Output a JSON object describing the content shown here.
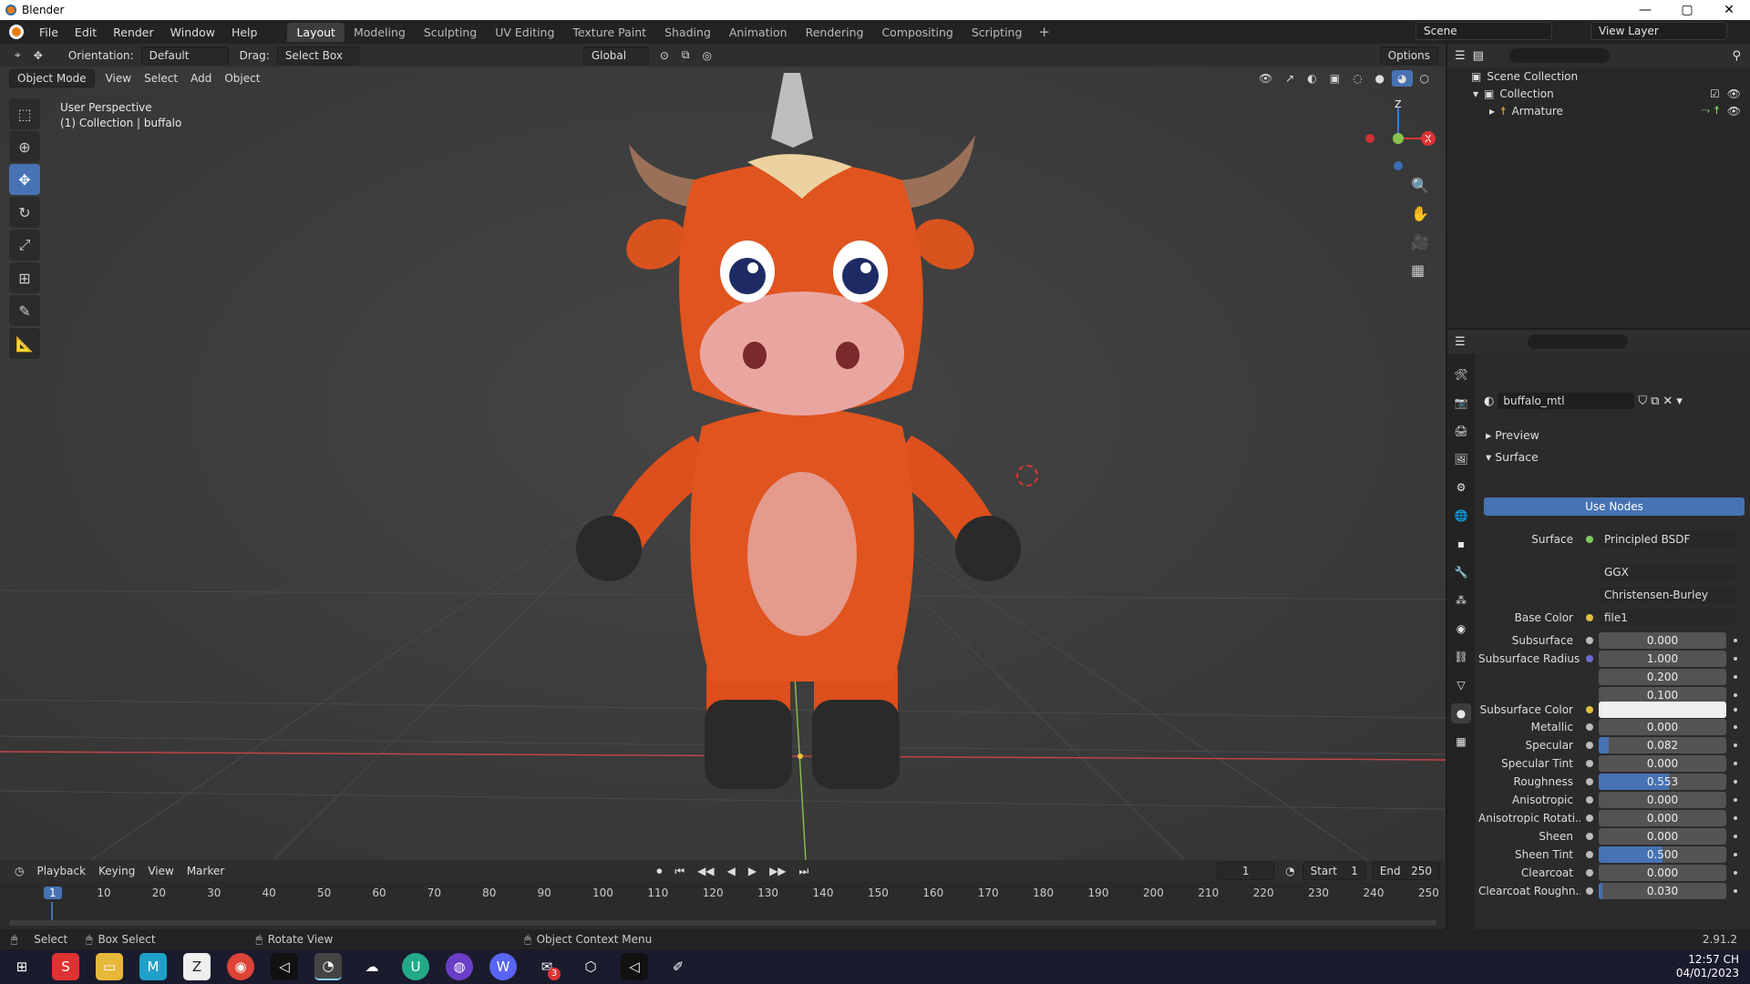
{
  "window": {
    "title": "Blender",
    "controls": [
      "—",
      "▢",
      "✕"
    ]
  },
  "menu": {
    "items": [
      "File",
      "Edit",
      "Render",
      "Window",
      "Help"
    ]
  },
  "workspaces": [
    "Layout",
    "Modeling",
    "Sculpting",
    "UV Editing",
    "Texture Paint",
    "Shading",
    "Animation",
    "Rendering",
    "Compositing",
    "Scripting"
  ],
  "workspaces_plus": "+",
  "scene": {
    "name": "Scene",
    "view_layer": "View Layer"
  },
  "viewport_header": {
    "orientation_label": "Orientation:",
    "orientation_value": "Default",
    "drag_label": "Drag:",
    "drag_value": "Select Box",
    "transform": "Global",
    "options": "Options"
  },
  "viewport_header2": {
    "mode": "Object Mode",
    "menus": [
      "View",
      "Select",
      "Add",
      "Object"
    ]
  },
  "viewport_info": {
    "line1": "User Perspective",
    "line2": "(1) Collection | buffalo"
  },
  "gizmo": {
    "z": "Z",
    "x": "X"
  },
  "outliner": {
    "rows": [
      {
        "label": "Scene Collection"
      },
      {
        "label": "Collection"
      },
      {
        "label": "Armature"
      }
    ]
  },
  "properties": {
    "material_name": "buffalo_mtl",
    "preview_label": "Preview",
    "surface_label": "Surface",
    "use_nodes": "Use Nodes",
    "surface_shader_label": "Surface",
    "surface_shader": "Principled BSDF",
    "distribution": "GGX",
    "subsurface_method": "Christensen-Burley",
    "base_color_label": "Base Color",
    "base_color_value": "file1",
    "rows": [
      {
        "label": "Subsurface",
        "value": "0.000",
        "fill": 0
      },
      {
        "label": "Subsurface Radius",
        "value": "1.000",
        "fill": 0
      },
      {
        "label": "",
        "value": "0.200",
        "fill": 0
      },
      {
        "label": "",
        "value": "0.100",
        "fill": 0
      },
      {
        "label": "Metallic",
        "value": "0.000",
        "fill": 0
      },
      {
        "label": "Specular",
        "value": "0.082",
        "fill": 0.082
      },
      {
        "label": "Specular Tint",
        "value": "0.000",
        "fill": 0
      },
      {
        "label": "Roughness",
        "value": "0.553",
        "fill": 0.553
      },
      {
        "label": "Anisotropic",
        "value": "0.000",
        "fill": 0
      },
      {
        "label": "Anisotropic Rotati...",
        "value": "0.000",
        "fill": 0
      },
      {
        "label": "Sheen",
        "value": "0.000",
        "fill": 0
      },
      {
        "label": "Sheen Tint",
        "value": "0.500",
        "fill": 0.5
      },
      {
        "label": "Clearcoat",
        "value": "0.000",
        "fill": 0
      },
      {
        "label": "Clearcoat Roughn...",
        "value": "0.030",
        "fill": 0.03
      }
    ],
    "subsurface_color_label": "Subsurface Color",
    "subsurface_color": "#f0f0f0"
  },
  "timeline": {
    "menus": [
      "Playback",
      "Keying",
      "View",
      "Marker"
    ],
    "current_frame": "1",
    "start_label": "Start",
    "start": "1",
    "end_label": "End",
    "end": "250",
    "ticks": [
      "1",
      "10",
      "20",
      "30",
      "40",
      "50",
      "60",
      "70",
      "80",
      "90",
      "100",
      "110",
      "120",
      "130",
      "140",
      "150",
      "160",
      "170",
      "180",
      "190",
      "200",
      "210",
      "220",
      "230",
      "240",
      "250"
    ]
  },
  "statusbar": {
    "select": "Select",
    "box_select": "Box Select",
    "rotate": "Rotate View",
    "context_menu": "Object Context Menu",
    "version": "2.91.2"
  },
  "taskbar": {
    "time": "12:57 CH",
    "date": "04/01/2023",
    "badge": "3"
  },
  "colors": {
    "accent": "#4772b3",
    "body": "#e0541f",
    "snout": "#e8a09a",
    "hoof": "#2a2a2a"
  }
}
